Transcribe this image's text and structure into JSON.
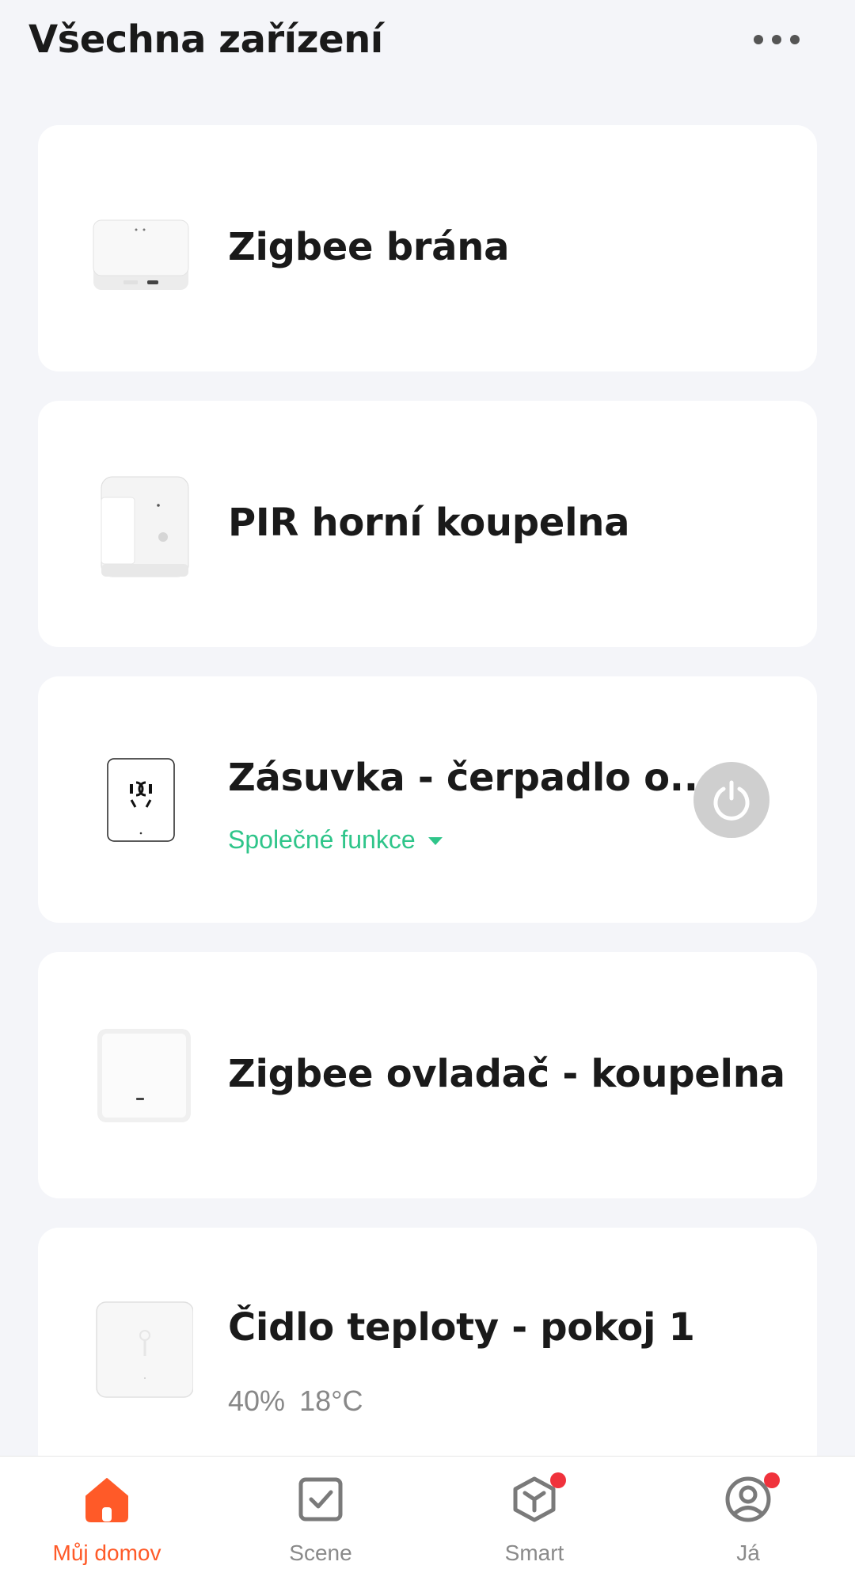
{
  "header": {
    "title": "Všechna zařízení"
  },
  "devices": [
    {
      "name": "Zigbee brána",
      "thumb_icon": "gateway-icon"
    },
    {
      "name": "PIR horní koupelna",
      "thumb_icon": "pir-sensor-icon"
    },
    {
      "name": "Zásuvka - čerpadlo o...",
      "thumb_icon": "socket-icon",
      "sub": "Společné funkce",
      "power_icon": "power-icon"
    },
    {
      "name": "Zigbee ovladač - koupelna",
      "thumb_icon": "remote-icon"
    },
    {
      "name": "Čidlo teploty - pokoj 1",
      "thumb_icon": "temperature-sensor-icon",
      "humidity": "40%",
      "temperature": "18°C"
    }
  ],
  "tabs": [
    {
      "label": "Můj domov",
      "icon": "home-icon",
      "active": true
    },
    {
      "label": "Scene",
      "icon": "scene-icon",
      "active": false
    },
    {
      "label": "Smart",
      "icon": "smart-icon",
      "active": false,
      "badge": true
    },
    {
      "label": "Já",
      "icon": "profile-icon",
      "active": false,
      "badge": true
    }
  ],
  "colors": {
    "accent": "#ff5a28",
    "green": "#2fc58a",
    "background": "#f4f5f9",
    "badge": "#f0323c"
  }
}
